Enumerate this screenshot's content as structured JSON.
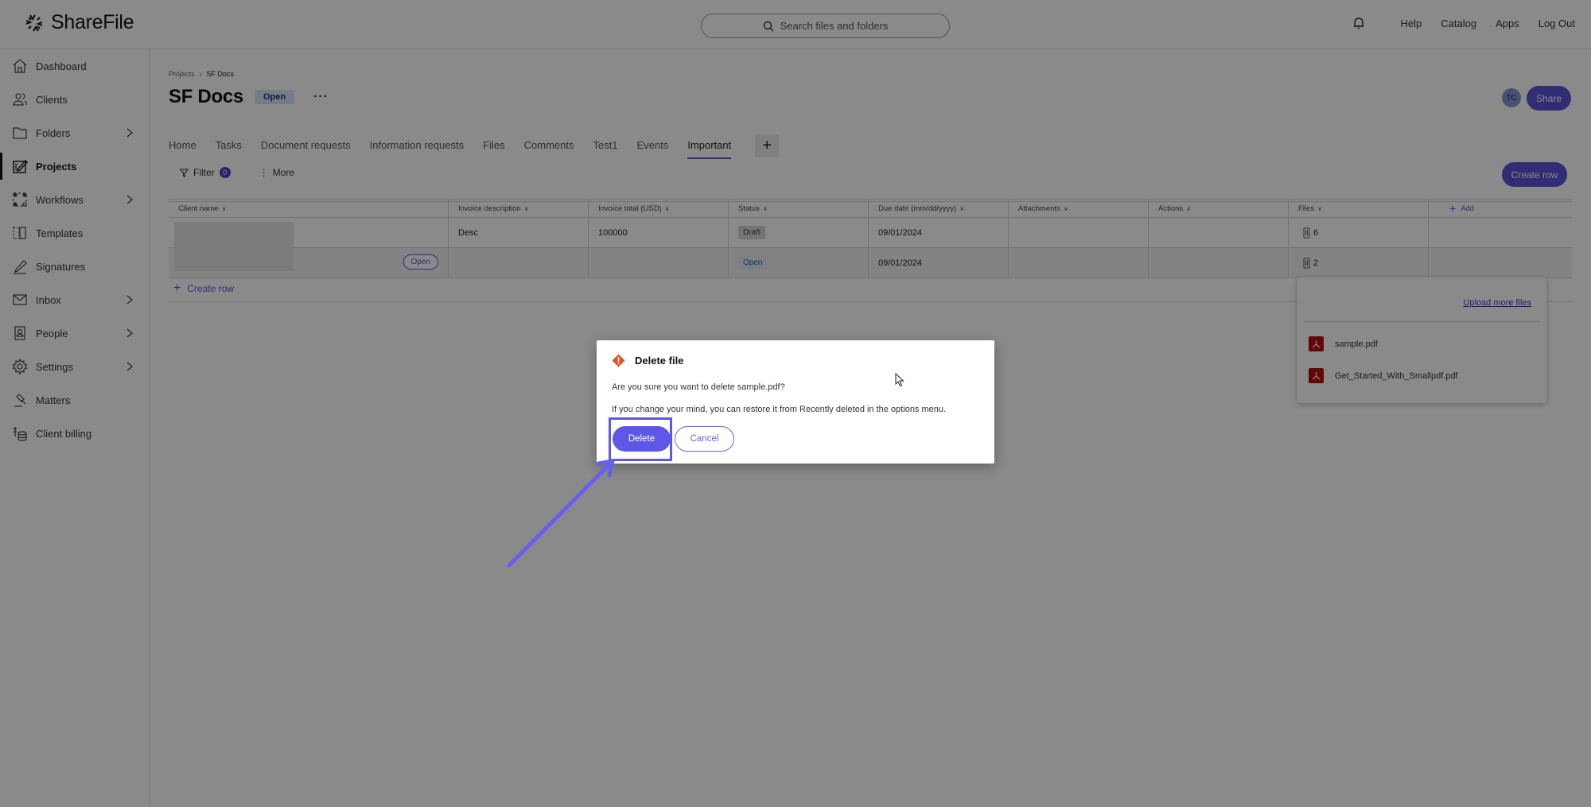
{
  "header": {
    "brand": "ShareFile",
    "search_placeholder": "Search files and folders",
    "links": [
      "Help",
      "Catalog",
      "Apps",
      "Log Out"
    ]
  },
  "sidebar": {
    "items": [
      {
        "label": "Dashboard",
        "icon": "home-icon",
        "has_chevron": false
      },
      {
        "label": "Clients",
        "icon": "clients-icon",
        "has_chevron": false
      },
      {
        "label": "Folders",
        "icon": "folder-icon",
        "has_chevron": true
      },
      {
        "label": "Projects",
        "icon": "projects-icon",
        "has_chevron": false,
        "active": true
      },
      {
        "label": "Workflows",
        "icon": "workflows-icon",
        "has_chevron": true
      },
      {
        "label": "Templates",
        "icon": "templates-icon",
        "has_chevron": false
      },
      {
        "label": "Signatures",
        "icon": "signature-icon",
        "has_chevron": false
      },
      {
        "label": "Inbox",
        "icon": "mail-icon",
        "has_chevron": true
      },
      {
        "label": "People",
        "icon": "people-icon",
        "has_chevron": true
      },
      {
        "label": "Settings",
        "icon": "gear-icon",
        "has_chevron": true
      },
      {
        "label": "Matters",
        "icon": "gavel-icon",
        "has_chevron": false
      },
      {
        "label": "Client billing",
        "icon": "billing-icon",
        "has_chevron": false
      }
    ]
  },
  "page": {
    "breadcrumb": [
      "Projects",
      "SF Docs"
    ],
    "title": "SF Docs",
    "status": "Open",
    "avatar_initials": "TC",
    "share_label": "Share",
    "tabs": [
      "Home",
      "Tasks",
      "Document requests",
      "Information requests",
      "Files",
      "Comments",
      "Test1",
      "Events",
      "Important"
    ],
    "active_tab": "Important",
    "add_tab_label": "+",
    "filter_label": "Filter",
    "filter_count": "0",
    "more_label": "More",
    "create_row_button": "Create row"
  },
  "table": {
    "columns": [
      "Client name",
      "Invoice description",
      "Invoice total (USD)",
      "Status",
      "Due date (mm/dd/yyyy)",
      "Attachments",
      "Actions",
      "Files"
    ],
    "add_column_label": "Add",
    "rows": [
      {
        "client": "",
        "description": "Desc",
        "total": "100000",
        "status": "Draft",
        "due": "09/01/2024",
        "attachments": "",
        "actions": "",
        "files": "6"
      },
      {
        "client": "",
        "open_button": "Open",
        "description": "",
        "total": "",
        "status": "Open",
        "due": "09/01/2024",
        "attachments": "",
        "actions": "",
        "files": "2"
      }
    ],
    "create_row_link": "Create row"
  },
  "files_popover": {
    "upload_link": "Upload more files",
    "files": [
      "sample.pdf",
      "Get_Started_With_Smallpdf.pdf"
    ]
  },
  "dialog": {
    "title": "Delete file",
    "question": "Are you sure you want to delete sample.pdf?",
    "info": "If you change your mind, you can restore it from Recently deleted in the options menu.",
    "delete_label": "Delete",
    "cancel_label": "Cancel"
  },
  "colors": {
    "accent": "#5b53d9",
    "danger_icon": "#e2541f",
    "pdf": "#b3100e"
  }
}
